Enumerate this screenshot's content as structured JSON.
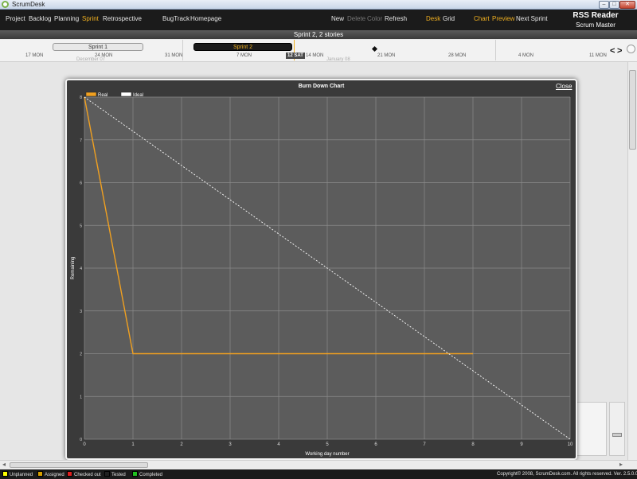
{
  "window": {
    "title": "ScrumDesk",
    "min": "–",
    "max": "□",
    "close": "✕"
  },
  "menu": {
    "left": [
      "Project",
      "Backlog",
      "Planning",
      "Sprint",
      "Retrospective"
    ],
    "mid": [
      "BugTrack",
      "Homepage"
    ],
    "actions": [
      "New",
      "Delete",
      "Color",
      "Refresh"
    ],
    "views": [
      "Desk",
      "Grid"
    ],
    "chart": [
      "Chart",
      "Preview",
      "Next Sprint"
    ],
    "brand": "RSS Reader",
    "role": "Scrum Master",
    "colors": {
      "active": "#f0b020",
      "disabled": "#777777"
    }
  },
  "sprint_header": "Sprint 2,  2 stories",
  "timeline": {
    "sprints": [
      "Sprint 1",
      "Sprint 2"
    ],
    "today": "12 SAT",
    "dates": [
      "17 MON",
      "24 MON",
      "31 MON",
      "7 MON",
      "14 MON",
      "21 MON",
      "28 MON",
      "4 MON",
      "11 MON"
    ],
    "months": [
      "December 07",
      "January 08"
    ],
    "nav": [
      "<",
      ">"
    ]
  },
  "dialog": {
    "title": "Burn Down Chart",
    "close": "Close"
  },
  "chart_data": {
    "type": "line",
    "title": "Burn Down Chart",
    "xlabel": "Working day number",
    "ylabel": "Remaining",
    "xlim": [
      0,
      10
    ],
    "ylim": [
      0,
      8
    ],
    "xticks": [
      0,
      1,
      2,
      3,
      4,
      5,
      6,
      7,
      8,
      9,
      10
    ],
    "yticks": [
      0,
      1,
      2,
      3,
      4,
      5,
      6,
      7,
      8
    ],
    "grid": true,
    "legend": "top-left",
    "series": [
      {
        "name": "Real",
        "color": "#f0a020",
        "points": [
          [
            0,
            8
          ],
          [
            1,
            2
          ],
          [
            8,
            2
          ]
        ]
      },
      {
        "name": "Ideal",
        "color": "#ffffff",
        "dashed": true,
        "points": [
          [
            0,
            8
          ],
          [
            10,
            0
          ]
        ]
      }
    ]
  },
  "statusbar": {
    "legend": [
      {
        "label": "Unplanned",
        "color": "#ffff00"
      },
      {
        "label": "Assigned",
        "color": "#d8a000"
      },
      {
        "label": "Checked out",
        "color": "#e02020"
      },
      {
        "label": "Tested",
        "color": "#202020"
      },
      {
        "label": "Completed",
        "color": "#20c020"
      }
    ],
    "copyright": "Copyright© 2008, ScrumDesk.com. All rights reserved. Ver. 2.5.0.0"
  }
}
